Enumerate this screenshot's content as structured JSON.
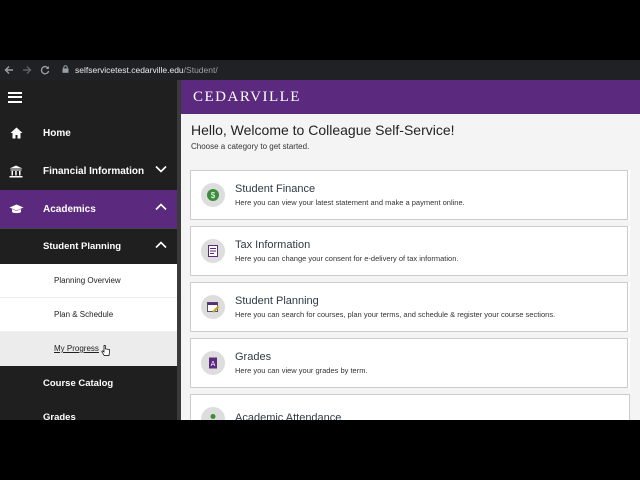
{
  "browser": {
    "url_domain": "selfservicetest.cedarville.edu",
    "url_path": "/Student/",
    "back_icon": "arrow-left-icon",
    "forward_icon": "arrow-right-icon",
    "reload_icon": "reload-icon"
  },
  "sidebar": {
    "items": [
      {
        "label": "Home",
        "icon": "home-icon"
      },
      {
        "label": "Financial Information",
        "icon": "bank-icon"
      },
      {
        "label": "Academics",
        "icon": "graduation-cap-icon"
      }
    ],
    "submenu_header": "Student Planning",
    "submenu": [
      {
        "label": "Planning Overview"
      },
      {
        "label": "Plan & Schedule"
      },
      {
        "label": "My Progress"
      }
    ],
    "after": [
      {
        "label": "Course Catalog"
      },
      {
        "label": "Grades"
      }
    ]
  },
  "header": {
    "brand": "CEDARVILLE",
    "brand_color": "#5b2a7e"
  },
  "welcome": {
    "title": "Hello, Welcome to Colleague Self-Service!",
    "subtitle": "Choose a category to get started."
  },
  "cards": [
    {
      "title": "Student Finance",
      "desc": "Here you can view your latest statement and make a payment online.",
      "icon": "money-icon",
      "color": "#3b8d3b"
    },
    {
      "title": "Tax Information",
      "desc": "Here you can change your consent for e-delivery of tax information.",
      "icon": "tax-form-icon",
      "color": "#5b2a7e"
    },
    {
      "title": "Student Planning",
      "desc": "Here you can search for courses, plan your terms, and schedule & register your course sections.",
      "icon": "calendar-icon",
      "color": "#c9a227"
    },
    {
      "title": "Grades",
      "desc": "Here you can view your grades by term.",
      "icon": "grade-report-icon",
      "color": "#5b2a7e"
    },
    {
      "title": "Academic Attendance",
      "desc": "",
      "icon": "person-icon",
      "color": "#3b8d3b"
    }
  ]
}
